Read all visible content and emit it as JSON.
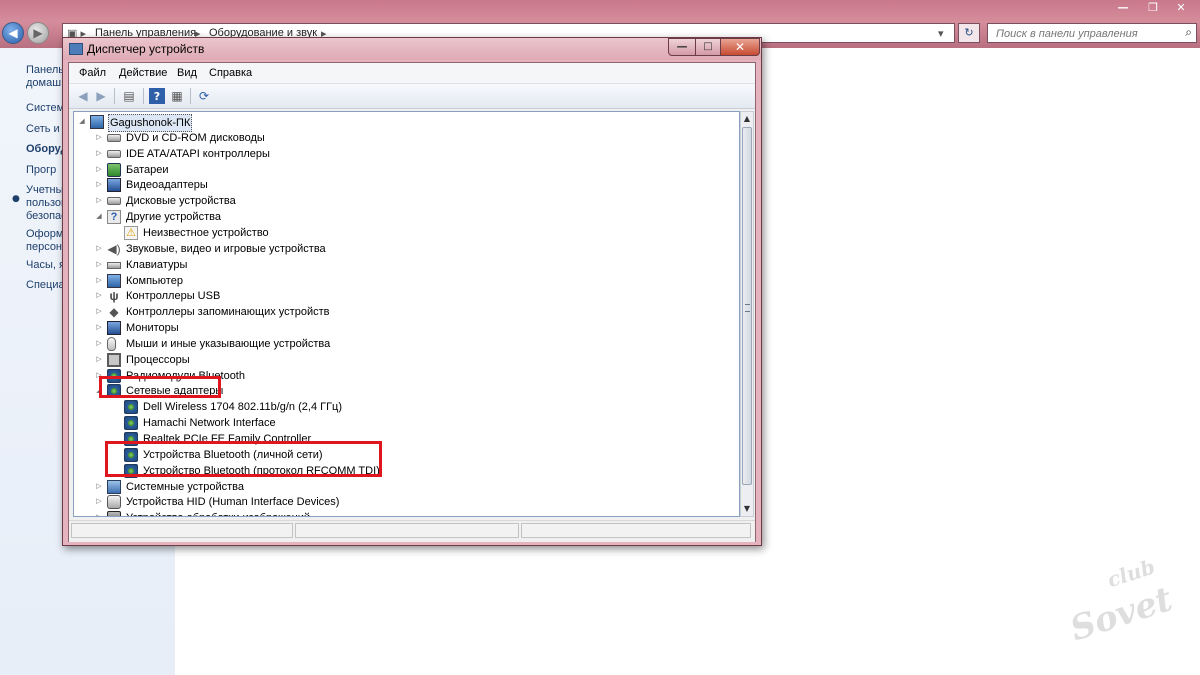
{
  "background_window": {
    "address_crumbs": [
      "Панель управления",
      "Оборудование и звук"
    ],
    "search_placeholder": "Поиск в панели управления",
    "left_links": [
      "Панель",
      "домаш",
      "Систем",
      "Сеть и и",
      "Оборуд",
      "Прогр",
      "Учетны",
      "пользов",
      "безопас",
      "Оформ",
      "персон",
      "Часы, я",
      "Специа"
    ],
    "active_link_index": 4
  },
  "window": {
    "title": "Диспетчер устройств",
    "menu": [
      "Файл",
      "Действие",
      "Вид",
      "Справка"
    ],
    "tree": [
      {
        "label": "Gagushonok-ПК",
        "level": 0,
        "expander": "open",
        "icon": "computer-icon"
      },
      {
        "label": "DVD и CD-ROM дисководы",
        "level": 1,
        "expander": "closed",
        "icon": "disc-drive-icon"
      },
      {
        "label": "IDE ATA/ATAPI контроллеры",
        "level": 1,
        "expander": "closed",
        "icon": "ide-controller-icon"
      },
      {
        "label": "Батареи",
        "level": 1,
        "expander": "closed",
        "icon": "battery-icon"
      },
      {
        "label": "Видеоадаптеры",
        "level": 1,
        "expander": "closed",
        "icon": "display-adapter-icon"
      },
      {
        "label": "Дисковые устройства",
        "level": 1,
        "expander": "closed",
        "icon": "disk-drive-icon"
      },
      {
        "label": "Другие устройства",
        "level": 1,
        "expander": "open",
        "icon": "unknown-device-category-icon"
      },
      {
        "label": "Неизвестное устройство",
        "level": 2,
        "expander": "none",
        "icon": "warning-device-icon"
      },
      {
        "label": "Звуковые, видео и игровые устройства",
        "level": 1,
        "expander": "closed",
        "icon": "speaker-icon"
      },
      {
        "label": "Клавиатуры",
        "level": 1,
        "expander": "closed",
        "icon": "keyboard-icon"
      },
      {
        "label": "Компьютер",
        "level": 1,
        "expander": "closed",
        "icon": "computer-icon"
      },
      {
        "label": "Контроллеры USB",
        "level": 1,
        "expander": "closed",
        "icon": "usb-icon"
      },
      {
        "label": "Контроллеры запоминающих устройств",
        "level": 1,
        "expander": "closed",
        "icon": "storage-controller-icon"
      },
      {
        "label": "Мониторы",
        "level": 1,
        "expander": "closed",
        "icon": "monitor-icon"
      },
      {
        "label": "Мыши и иные указывающие устройства",
        "level": 1,
        "expander": "closed",
        "icon": "mouse-icon"
      },
      {
        "label": "Процессоры",
        "level": 1,
        "expander": "closed",
        "icon": "processor-icon"
      },
      {
        "label": "Радиомодули Bluetooth",
        "level": 1,
        "expander": "closed",
        "icon": "bluetooth-radio-icon"
      },
      {
        "label": "Сетевые адаптеры",
        "level": 1,
        "expander": "open",
        "icon": "network-adapter-icon"
      },
      {
        "label": "Dell Wireless 1704 802.11b/g/n (2,4 ГГц)",
        "level": 2,
        "expander": "none",
        "icon": "network-adapter-icon"
      },
      {
        "label": "Hamachi Network Interface",
        "level": 2,
        "expander": "none",
        "icon": "network-adapter-icon"
      },
      {
        "label": "Realtek PCIe FE Family Controller",
        "level": 2,
        "expander": "none",
        "icon": "network-adapter-icon"
      },
      {
        "label": "Устройства Bluetooth (личной сети)",
        "level": 2,
        "expander": "none",
        "icon": "network-adapter-icon"
      },
      {
        "label": "Устройство Bluetooth (протокол RFCOMM TDI)",
        "level": 2,
        "expander": "none",
        "icon": "network-adapter-icon"
      },
      {
        "label": "Системные устройства",
        "level": 1,
        "expander": "closed",
        "icon": "system-devices-icon"
      },
      {
        "label": "Устройства HID (Human Interface Devices)",
        "level": 1,
        "expander": "closed",
        "icon": "hid-icon"
      },
      {
        "label": "Устройства обработки изображений",
        "level": 1,
        "expander": "closed",
        "icon": "imaging-device-icon"
      }
    ]
  },
  "watermark": {
    "club": "club",
    "sovet": "Sovet"
  },
  "colors": {
    "highlight": "#e0161f",
    "title_bar": "#deaab4",
    "link": "#1e3f6b"
  }
}
